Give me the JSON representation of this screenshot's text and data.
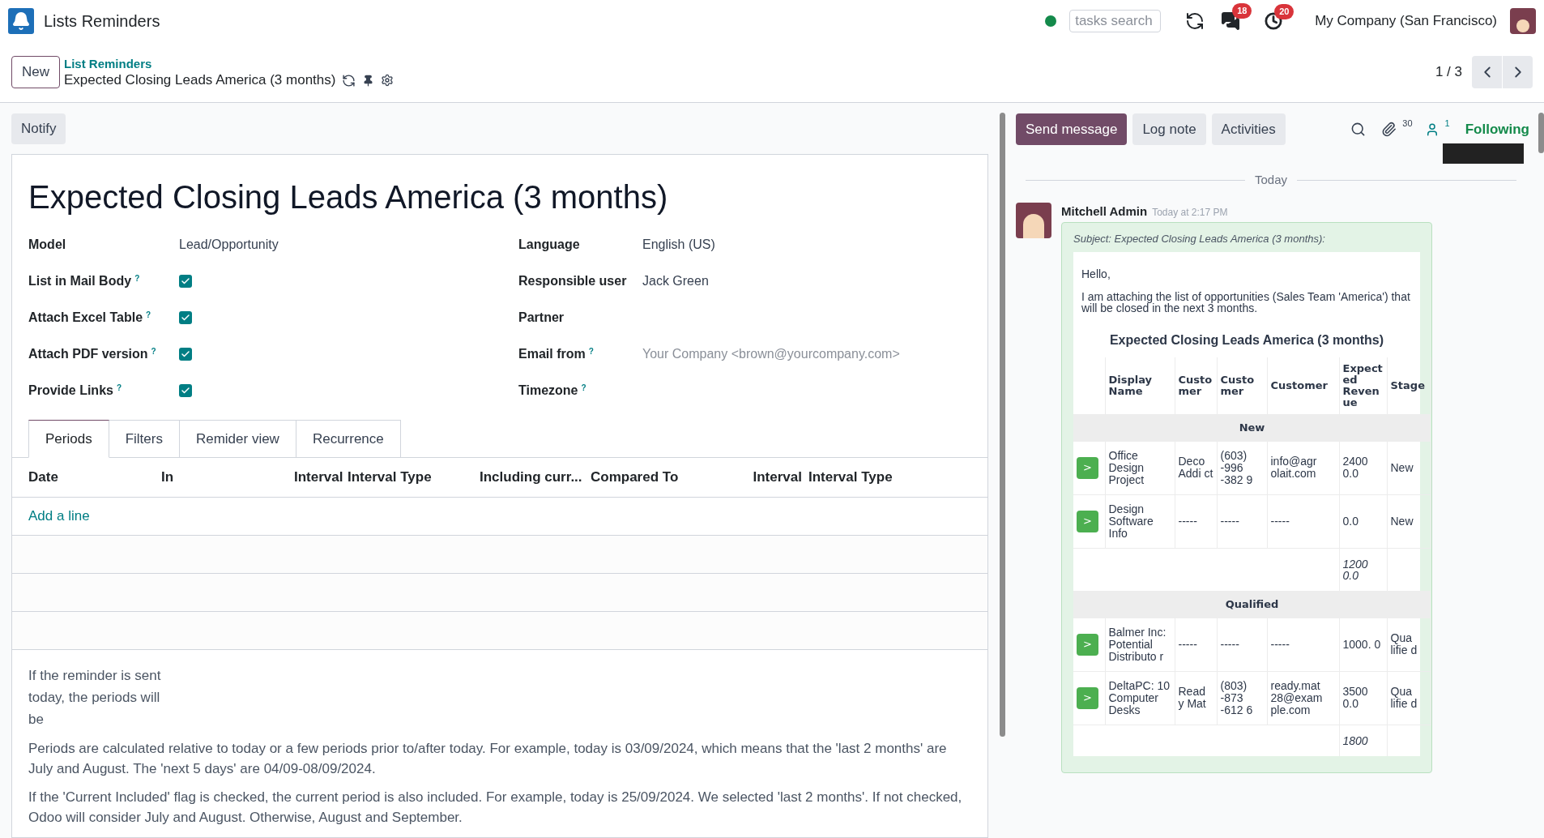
{
  "navbar": {
    "app_title": "Lists Reminders",
    "search": {
      "placeholder": "tasks search"
    },
    "messages_badge": "18",
    "activities_badge": "20",
    "company": "My Company (San Francisco)"
  },
  "control_panel": {
    "new_button": "New",
    "breadcrumb": "List Reminders",
    "record_title": "Expected Closing Leads America (3 months)",
    "pager": "1 / 3"
  },
  "form": {
    "notify_button": "Notify",
    "title": "Expected Closing Leads America (3 months)",
    "left_fields": [
      {
        "kind": "text",
        "label": "Model",
        "value": "Lead/Opportunity"
      },
      {
        "kind": "checkbox",
        "label": "List in Mail Body",
        "help": "?",
        "checked": true
      },
      {
        "kind": "checkbox",
        "label": "Attach Excel Table",
        "help": "?",
        "checked": true
      },
      {
        "kind": "checkbox",
        "label": "Attach PDF version",
        "help": "?",
        "checked": true
      },
      {
        "kind": "checkbox",
        "label": "Provide Links",
        "help": "?",
        "checked": true
      }
    ],
    "right_fields": [
      {
        "kind": "text",
        "label": "Language",
        "value": "English (US)"
      },
      {
        "kind": "text",
        "label": "Responsible user",
        "value": "Jack Green"
      },
      {
        "kind": "text",
        "label": "Partner"
      },
      {
        "kind": "input",
        "label": "Email from",
        "help": "?",
        "placeholder": "Your Company <brown@yourcompany.com>"
      },
      {
        "kind": "text",
        "label": "Timezone",
        "help": "?"
      }
    ],
    "tabs": [
      {
        "label": "Periods",
        "selected": true
      },
      {
        "label": "Filters",
        "selected": false
      },
      {
        "label": "Remider view",
        "selected": false
      },
      {
        "label": "Recurrence",
        "selected": false
      }
    ],
    "periods_table": {
      "columns": [
        "Date",
        "In",
        "Interval",
        "Interval Type",
        "Including curr...",
        "Compared To",
        "Interval",
        "Interval Type"
      ],
      "add_line": "Add a line"
    },
    "help_label": "If the reminder is sent today, the periods will be",
    "help_paragraphs": [
      "Periods are calculated relative to today or a few periods prior to/after today. For example, today is 03/09/2024, which means that the 'last 2 months' are July and August. The 'next 5 days' are 04/09-08/09/2024.",
      "If the 'Current Included' flag is checked, the current period is also included. For example, today is 25/09/2024. We selected 'last 2 months'. If not checked, Odoo will consider July and August. Otherwise, August and September."
    ]
  },
  "chatter": {
    "buttons": [
      {
        "label": "Send message",
        "selected": true
      },
      {
        "label": "Log note",
        "selected": false
      },
      {
        "label": "Activities",
        "selected": false
      }
    ],
    "attachments_count": "30",
    "followers_count": "1",
    "following": "Following",
    "date_separator": "Today",
    "message": {
      "author": "Mitchell Admin",
      "time": "Today at 2:17 PM",
      "subject": "Subject: Expected Closing Leads America (3 months):",
      "greeting": "Hello,",
      "body": "I am attaching the list of opportunities (Sales Team 'America') that will be closed in the next 3 months.",
      "heading": "Expected Closing Leads America (3 months)",
      "columns": [
        "Display Name",
        "Custo mer",
        "Custo mer",
        "Customer",
        "Expect ed Reven ue",
        "Stage"
      ],
      "groups": [
        {
          "name": "New",
          "rows": [
            {
              "button": ">",
              "cells": [
                "Office Design Project",
                "Deco Addi ct",
                "(603) -996 -382 9",
                "info@agr olait.com",
                "2400 0.0",
                "New"
              ]
            },
            {
              "button": ">",
              "cells": [
                "Design Software Info",
                "-----",
                "-----",
                "-----",
                "0.0",
                "New"
              ]
            }
          ],
          "total": "1200 0.0"
        },
        {
          "name": "Qualified",
          "rows": [
            {
              "button": ">",
              "cells": [
                "Balmer Inc: Potential Distributo r",
                "-----",
                "-----",
                "-----",
                "1000. 0",
                "Qua lifie d"
              ]
            },
            {
              "button": ">",
              "cells": [
                "DeltaPC: 10 Computer Desks",
                "Read y Mat",
                "(803) -873 -612 6",
                "ready.mat 28@exam ple.com",
                "3500 0.0",
                "Qua lifie d"
              ]
            }
          ],
          "total": "1800"
        }
      ]
    }
  }
}
